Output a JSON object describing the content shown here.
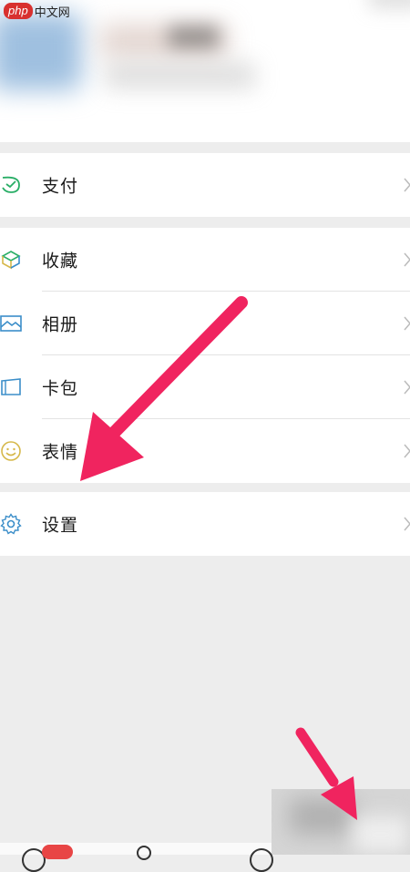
{
  "watermark": {
    "logo": "php",
    "text": "中文网"
  },
  "menu": {
    "pay": {
      "label": "支付"
    },
    "favorites": {
      "label": "收藏"
    },
    "album": {
      "label": "相册"
    },
    "cards": {
      "label": "卡包"
    },
    "stickers": {
      "label": "表情"
    },
    "settings": {
      "label": "设置"
    }
  },
  "icons": {
    "pay": "wallet-check-icon",
    "favorites": "cube-icon",
    "album": "photo-icon",
    "cards": "card-icon",
    "stickers": "smiley-icon",
    "settings": "gear-icon",
    "chevron": "chevron-right-icon"
  },
  "colors": {
    "background": "#ededed",
    "icon_green": "#2aae67",
    "icon_yellow": "#d6b84a",
    "icon_blue": "#3b8ec9",
    "arrow": "#f0245f",
    "badge": "#e84545"
  }
}
